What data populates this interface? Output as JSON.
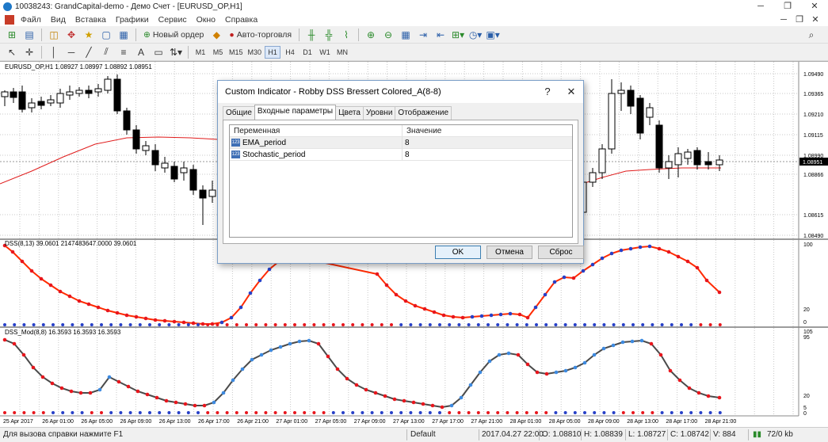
{
  "window": {
    "title": "10038243: GrandCapital-demo - Демо Счет - [EURUSD_OP,H1]",
    "controls": [
      "─",
      "❐",
      "✕"
    ]
  },
  "menu": {
    "items": [
      "Файл",
      "Вид",
      "Вставка",
      "Графики",
      "Сервис",
      "Окно",
      "Справка"
    ],
    "right": [
      "─",
      "❐",
      "✕"
    ]
  },
  "toolbar": {
    "new_order": "Новый ордер",
    "auto_trading": "Авто-торговля",
    "timeframes": [
      "M1",
      "M5",
      "M15",
      "M30",
      "H1",
      "H4",
      "D1",
      "W1",
      "MN"
    ],
    "selected_tf": "H1"
  },
  "chart": {
    "main_label": "EURUSD_OP,H1  1.08927 1.08997 1.08892 1.08951",
    "price_scale": [
      "1.09490",
      "1.09365",
      "1.09210",
      "1.09115",
      "1.08990",
      "1.08866",
      "1.08615",
      "1.08490"
    ],
    "current_price": "1.08951",
    "ind1_label": "DSS(8,13) 39.0601 2147483647.0000 39.0601",
    "ind1_scale": [
      "100",
      "20",
      "0"
    ],
    "ind2_label": "DSS_Mod(8,8) 16.3593 16.3593 16.3593",
    "ind2_scale": [
      "105",
      "95",
      "20",
      "5",
      "0"
    ],
    "time_labels": [
      "25 Apr 2017",
      "26 Apr 01:00",
      "26 Apr 05:00",
      "26 Apr 09:00",
      "26 Apr 13:00",
      "26 Apr 17:00",
      "26 Apr 21:00",
      "27 Apr 01:00",
      "27 Apr 05:00",
      "27 Apr 09:00",
      "27 Apr 13:00",
      "27 Apr 17:00",
      "27 Apr 21:00",
      "28 Apr 01:00",
      "28 Apr 05:00",
      "28 Apr 09:00",
      "28 Apr 13:00",
      "28 Apr 17:00",
      "28 Apr 21:00"
    ],
    "colors": {
      "up": "#ffffff",
      "down": "#000000",
      "ema": "#e01c1c",
      "dss_line": "#ff2a00",
      "dot_red": "#e8161d",
      "dot_blue": "#2740c8",
      "mod_line": "#4a4a4a",
      "mod_dot_blue": "#3d8ae0"
    }
  },
  "dialog": {
    "title": "Custom Indicator - Robby DSS Bressert Colored_A(8-8)",
    "help": "?",
    "close": "✕",
    "tabs": [
      "Общие",
      "Входные параметры",
      "Цвета",
      "Уровни",
      "Отображение"
    ],
    "active_tab": 1,
    "col_var": "Переменная",
    "col_val": "Значение",
    "params": [
      {
        "name": "EMA_period",
        "value": "8"
      },
      {
        "name": "Stochastic_period",
        "value": "8"
      }
    ],
    "buttons": {
      "ok": "OK",
      "cancel": "Отмена",
      "reset": "Сброс"
    }
  },
  "status": {
    "help": "Для вызова справки нажмите F1",
    "profile": "Default",
    "time": "2017.04.27 22:00",
    "open": "O: 1.08810",
    "high": "H: 1.08839",
    "low": "L: 1.08727",
    "close": "C: 1.08742",
    "volume": "V: 884",
    "traffic": "72/0 kb"
  }
}
